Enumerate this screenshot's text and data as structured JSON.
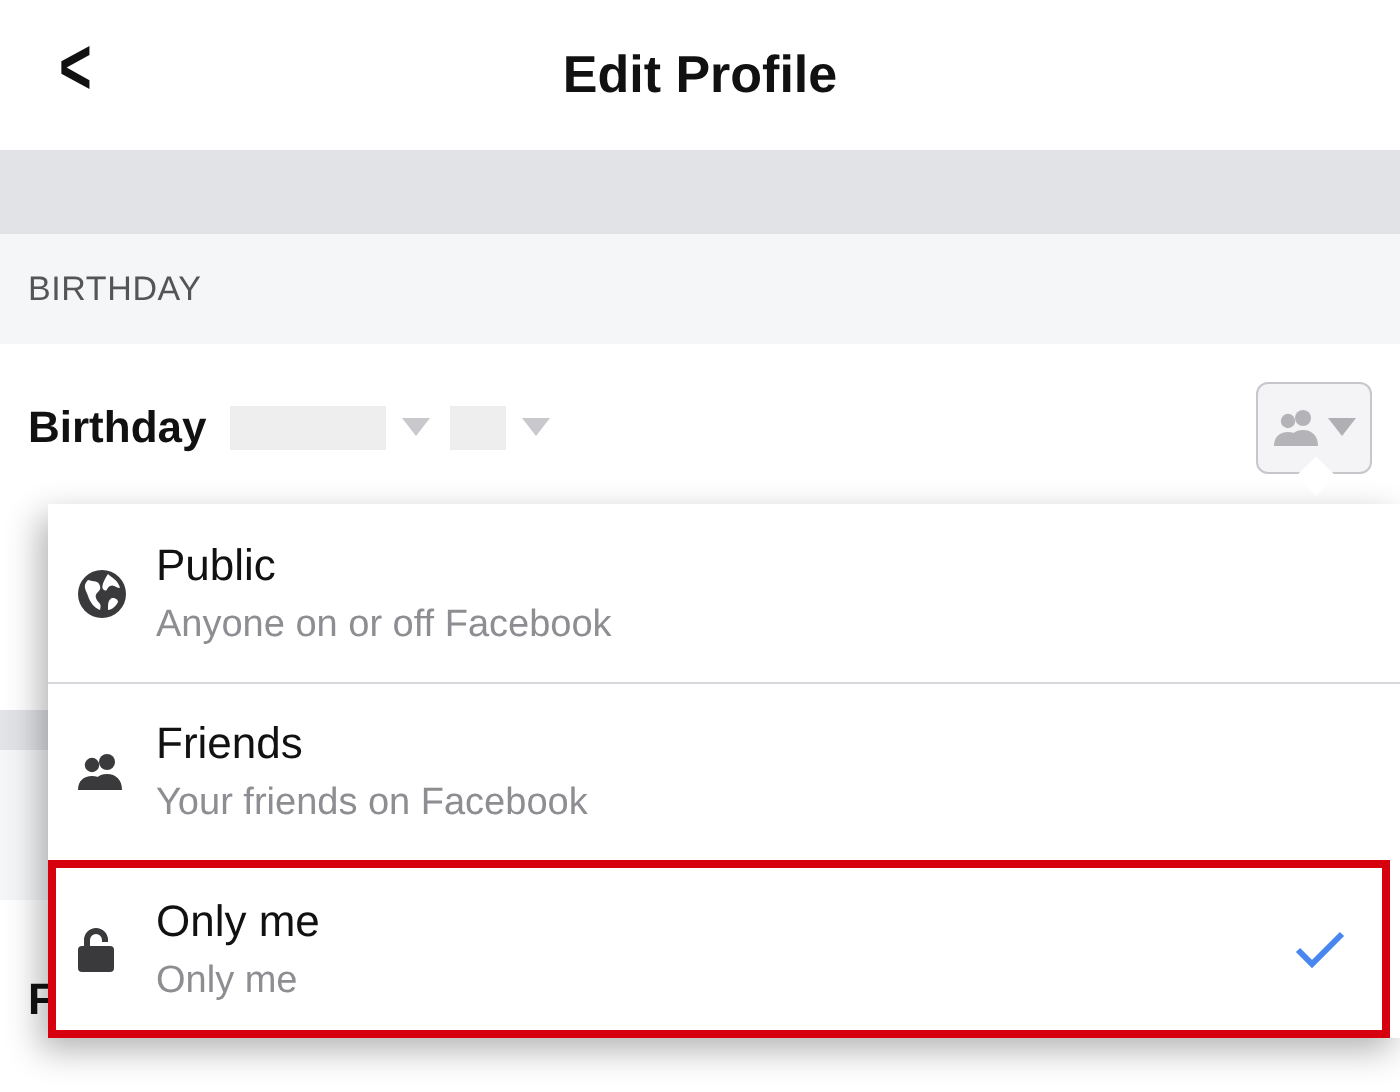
{
  "header": {
    "back": "<",
    "title": "Edit Profile"
  },
  "section": {
    "title": "BIRTHDAY"
  },
  "birthday_row": {
    "label": "Birthday",
    "date_selects": [
      {
        "disabled": true
      },
      {
        "disabled": true
      }
    ],
    "privacy_button": {
      "expanded": true
    }
  },
  "hidden_rows": [
    {
      "kind": "row"
    },
    {
      "kind": "section"
    },
    {
      "kind": "row",
      "text": "F"
    }
  ],
  "privacy_menu": [
    {
      "kind": "public",
      "title": "Public",
      "subtitle": "Anyone on or off Facebook",
      "selected": false
    },
    {
      "kind": "friends",
      "title": "Friends",
      "subtitle": "Your friends on Facebook",
      "selected": false
    },
    {
      "kind": "only_me",
      "title": "Only me",
      "subtitle": "Only me",
      "selected": true
    }
  ]
}
